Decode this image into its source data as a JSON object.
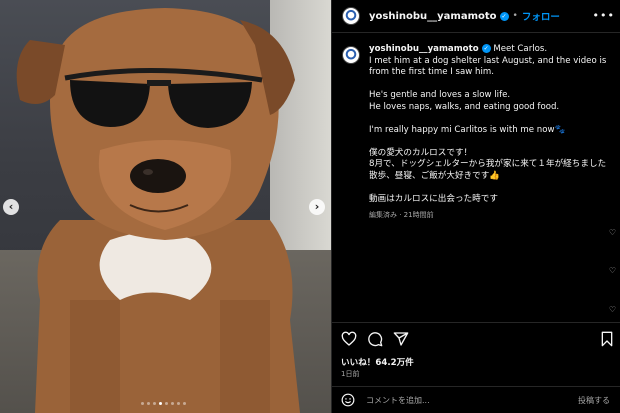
{
  "post": {
    "username": "yoshinobu__yamamoto",
    "verified_icon": "verified-badge-icon",
    "dot": "•",
    "follow_label": "フォロー",
    "more_icon": "more-options-icon"
  },
  "caption": {
    "username": "yoshinobu__yamamoto",
    "lines": [
      "Meet Carlos.",
      "I met him at a dog shelter last August, and the video is from the first time I saw him.",
      "",
      "He's gentle and loves a slow life.",
      "He loves naps, walks, and eating good food.",
      "",
      "I'm really happy mi Carlitos is with me now🐾",
      "",
      "僕の愛犬のカルロスです！",
      "8月で、ドッグシェルターから我が家に来て１年が経ちました",
      "散歩、昼寝、ご飯が大好きです👍",
      "",
      "動画はカルロスに出会った時です"
    ],
    "meta": "編集済み · 21時間前"
  },
  "actions": {
    "like_icon": "heart-icon",
    "comment_icon": "comment-icon",
    "share_icon": "share-icon",
    "save_icon": "bookmark-icon",
    "likes_text": "いいね！64.2万件",
    "time_text": "1日前"
  },
  "comment_box": {
    "emoji_icon": "emoji-icon",
    "placeholder": "コメントを追加...",
    "post_label": "投稿する"
  },
  "carousel": {
    "prev_glyph": "‹",
    "next_glyph": "›",
    "dot_count": 8,
    "active_dot": 3
  },
  "colors": {
    "accent": "#0095f6",
    "background": "#000000",
    "text": "#f5f5f5",
    "muted": "#a8a8a8"
  }
}
